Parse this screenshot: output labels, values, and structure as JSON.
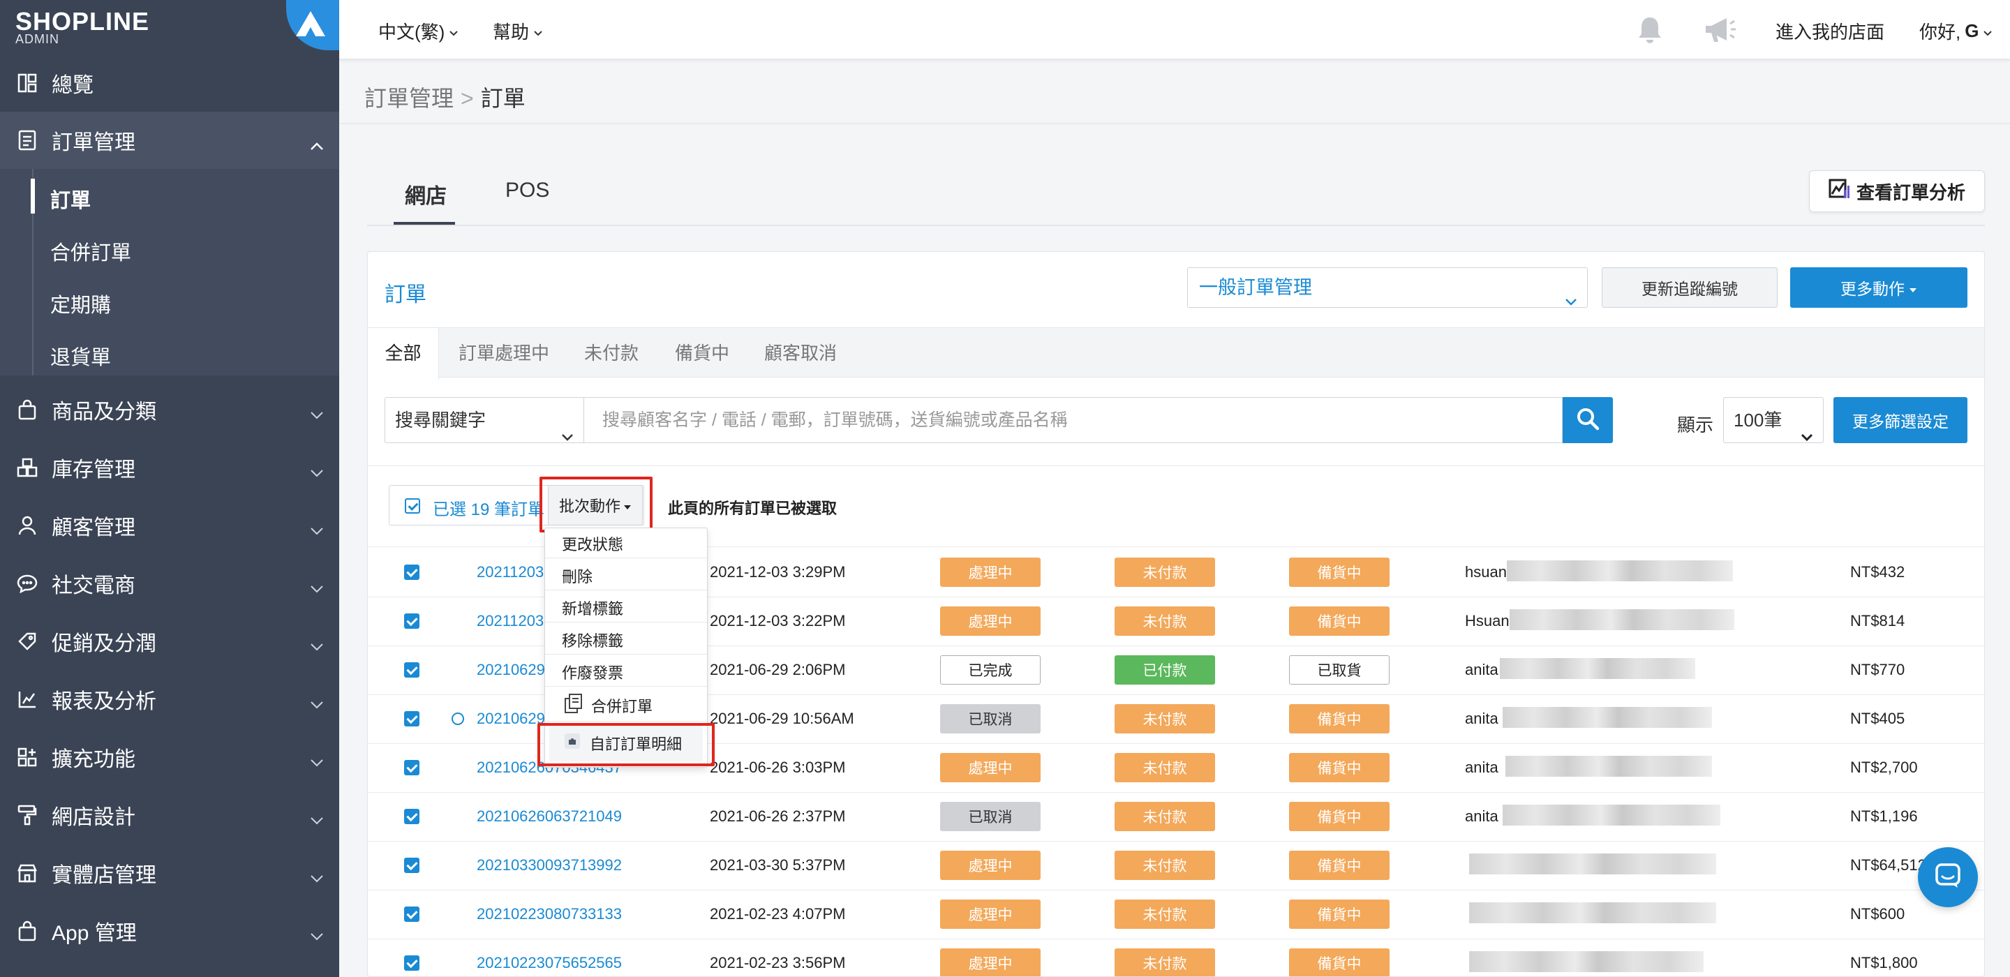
{
  "brand": {
    "logo": "SHOPLINE",
    "sub": "ADMIN"
  },
  "sidebar": {
    "items": [
      {
        "label": "總覽",
        "icon": "overview-icon"
      },
      {
        "label": "訂單管理",
        "icon": "orders-icon"
      },
      {
        "label": "商品及分類",
        "icon": "bag-icon"
      },
      {
        "label": "庫存管理",
        "icon": "inventory-icon"
      },
      {
        "label": "顧客管理",
        "icon": "user-icon"
      },
      {
        "label": "社交電商",
        "icon": "chat-icon"
      },
      {
        "label": "促銷及分潤",
        "icon": "tag-icon"
      },
      {
        "label": "報表及分析",
        "icon": "chart-icon"
      },
      {
        "label": "擴充功能",
        "icon": "apps-icon"
      },
      {
        "label": "網店設計",
        "icon": "brush-icon"
      },
      {
        "label": "實體店管理",
        "icon": "store-icon"
      },
      {
        "label": "App 管理",
        "icon": "bag-icon"
      }
    ],
    "subitems": [
      "訂單",
      "合併訂單",
      "定期購",
      "退貨單"
    ]
  },
  "topbar": {
    "language": "中文(繁)",
    "help": "幫助",
    "enter_store": "進入我的店面",
    "greeting": "你好,",
    "user_initial": "G"
  },
  "breadcrumb": {
    "parent": "訂單管理",
    "current": "訂單"
  },
  "main_tabs": [
    "網店",
    "POS"
  ],
  "analysis_button": "查看訂單分析",
  "panel": {
    "title": "訂單",
    "management_select": "一般訂單管理",
    "update_tracking": "更新追蹤編號",
    "more_actions": "更多動作",
    "status_tabs": [
      "全部",
      "訂單處理中",
      "未付款",
      "備貨中",
      "顧客取消"
    ],
    "keyword_select": "搜尋關鍵字",
    "search_placeholder": "搜尋顧客名字 / 電話 / 電郵，訂單號碼，送貨編號或產品名稱",
    "show_label": "顯示",
    "per_page": "100筆",
    "more_filters": "更多篩選設定",
    "selected_count": "已選 19 筆訂單",
    "batch_actions": "批次動作",
    "page_selected_note": "此頁的所有訂單已被選取"
  },
  "batch_menu": [
    "更改狀態",
    "刪除",
    "新增標籤",
    "移除標籤",
    "作廢發票",
    "合併訂單",
    "自訂訂單明細"
  ],
  "orders": [
    {
      "no": "20211203",
      "date": "2021-12-03 3:29PM",
      "order_status": "處理中",
      "payment": "未付款",
      "delivery": "備貨中",
      "customer": "hsuan",
      "amount": "NT$432"
    },
    {
      "no": "20211203",
      "date": "2021-12-03 3:22PM",
      "order_status": "處理中",
      "payment": "未付款",
      "delivery": "備貨中",
      "customer": "Hsuan",
      "amount": "NT$814"
    },
    {
      "no": "20210629",
      "date": "2021-06-29 2:06PM",
      "order_status": "已完成",
      "payment": "已付款",
      "delivery": "已取貨",
      "customer": "anita",
      "amount": "NT$770"
    },
    {
      "no": "20210629",
      "date": "2021-06-29 10:56AM",
      "order_status": "已取消",
      "payment": "未付款",
      "delivery": "備貨中",
      "customer": "anita",
      "amount": "NT$405"
    },
    {
      "no": "20210626070346437",
      "date": "2021-06-26 3:03PM",
      "order_status": "處理中",
      "payment": "未付款",
      "delivery": "備貨中",
      "customer": "anita",
      "amount": "NT$2,700"
    },
    {
      "no": "20210626063721049",
      "date": "2021-06-26 2:37PM",
      "order_status": "已取消",
      "payment": "未付款",
      "delivery": "備貨中",
      "customer": "anita",
      "amount": "NT$1,196"
    },
    {
      "no": "20210330093713992",
      "date": "2021-03-30 5:37PM",
      "order_status": "處理中",
      "payment": "未付款",
      "delivery": "備貨中",
      "customer": "",
      "amount": "NT$64,512"
    },
    {
      "no": "20210223080733133",
      "date": "2021-02-23 4:07PM",
      "order_status": "處理中",
      "payment": "未付款",
      "delivery": "備貨中",
      "customer": "",
      "amount": "NT$600"
    },
    {
      "no": "20210223075652565",
      "date": "2021-02-23 3:56PM",
      "order_status": "處理中",
      "payment": "未付款",
      "delivery": "備貨中",
      "customer": "",
      "amount": "NT$1,800"
    }
  ],
  "colors": {
    "sidebar": "#3b4455",
    "accent": "#1a8ad4",
    "processing": "#f3a85a",
    "paid": "#5cb85c",
    "highlight": "#e0261e"
  }
}
